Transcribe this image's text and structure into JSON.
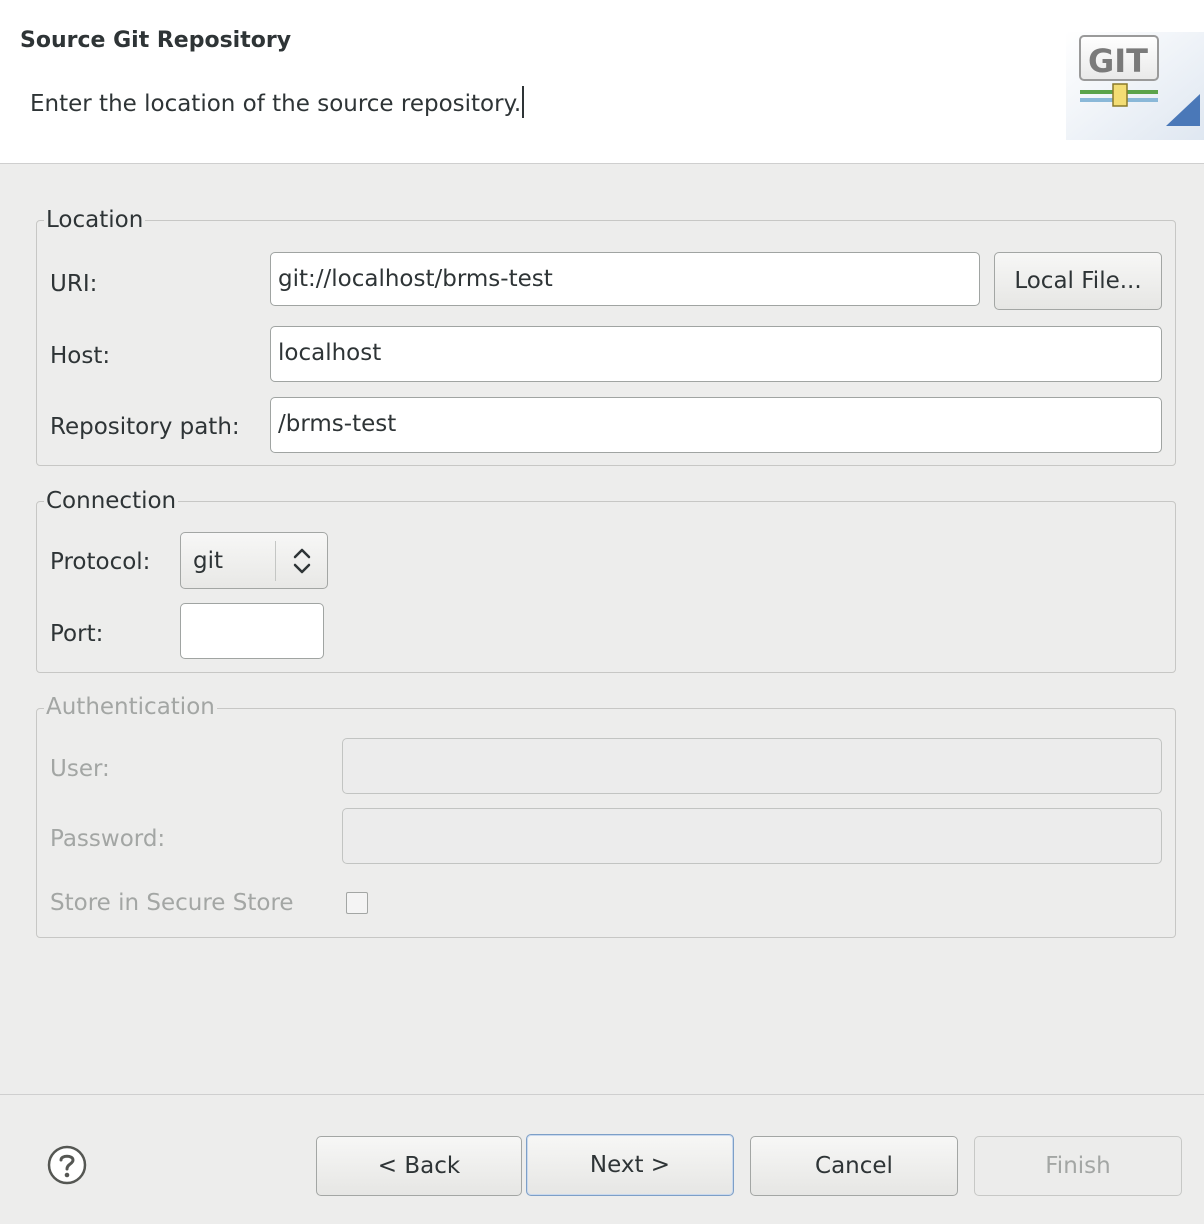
{
  "header": {
    "title": "Source Git Repository",
    "description": "Enter the location of the source repository.",
    "logo_text": "GIT"
  },
  "location": {
    "legend": "Location",
    "uri_label": "URI:",
    "uri_value": "git://localhost/brms-test",
    "local_file_button": "Local File...",
    "host_label": "Host:",
    "host_value": "localhost",
    "repo_path_label": "Repository path:",
    "repo_path_value": "/brms-test"
  },
  "connection": {
    "legend": "Connection",
    "protocol_label": "Protocol:",
    "protocol_value": "git",
    "port_label": "Port:",
    "port_value": ""
  },
  "authentication": {
    "legend": "Authentication",
    "user_label": "User:",
    "user_value": "",
    "password_label": "Password:",
    "password_value": "",
    "store_label": "Store in Secure Store",
    "store_checked": false
  },
  "footer": {
    "back": "< Back",
    "next": "Next >",
    "cancel": "Cancel",
    "finish": "Finish"
  },
  "icons": {
    "help": "help-icon",
    "logo": "git-logo",
    "spinner": "chevron-up-down-icon"
  },
  "colors": {
    "background": "#ededec",
    "header_bg": "#ffffff",
    "text": "#2e3436",
    "disabled_text": "#a3a6a4",
    "default_button_border": "#7d9fc7",
    "logo_green": "#5aa34a",
    "logo_red": "#d93a2b"
  }
}
